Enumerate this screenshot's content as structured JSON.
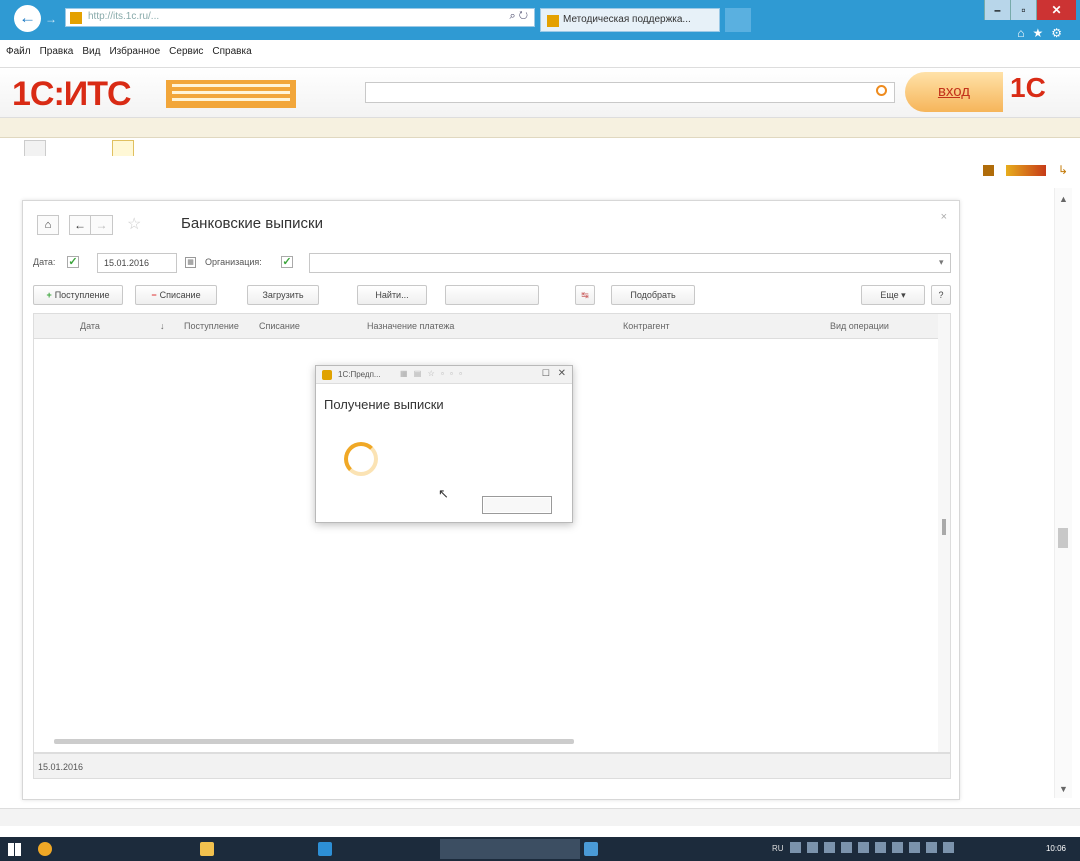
{
  "browser": {
    "address": "http://its.1c.ru/...",
    "tab_title": "Методическая поддержка...",
    "menu": [
      "Файл",
      "Правка",
      "Вид",
      "Избранное",
      "Сервис",
      "Справка"
    ]
  },
  "its": {
    "logo": "1С:ИТС",
    "login": "вход",
    "logo_right": "1С"
  },
  "breadcrumbs": {
    "left": "",
    "right": ""
  },
  "subtabs": [
    "",
    ""
  ],
  "old_search_link": "",
  "page": {
    "title": "",
    "subtitle": ""
  },
  "form": {
    "title": "Банковские выписки",
    "date_label": "Дата:",
    "date_value": "15.01.2016",
    "org_label": "Организация:",
    "org_value": "",
    "buttons": {
      "receipt": "Поступление",
      "writeoff": "Списание",
      "load": "Загрузить",
      "find": "Найти...",
      "cancel_search": "",
      "match": "Подобрать",
      "more": "Еще"
    },
    "columns": [
      "",
      "Дата",
      "",
      "Поступление",
      "Списание",
      "Назначение платежа",
      "Контрагент",
      "Вид операции"
    ],
    "footer": {
      "date": "15.01.2016",
      "start": "",
      "received": "",
      "written_off": "",
      "end": ""
    }
  },
  "modal": {
    "title": "1С:Предп...",
    "heading": "Получение выписки",
    "wait": "",
    "cancel": ""
  },
  "status": {
    "left1": "",
    "left2": "",
    "right1": "",
    "right2": ""
  },
  "taskbar": {
    "lang": "RU",
    "clock": "10:06"
  },
  "colors": {
    "titlebar": "#2f9ad3",
    "its_red": "#d92b15",
    "accent_orange": "#f0a826",
    "check_green": "#3da53d"
  }
}
